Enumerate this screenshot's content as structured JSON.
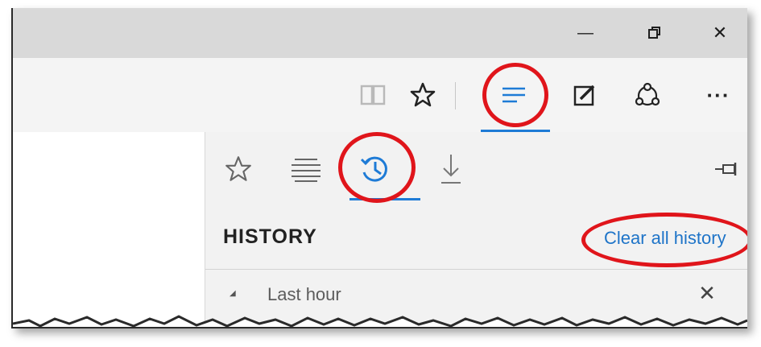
{
  "window_controls": {
    "minimize_icon": "minimize-icon",
    "restore_icon": "restore-icon",
    "close_icon": "close-icon",
    "minimize_glyph": "—",
    "close_glyph": "✕"
  },
  "toolbar": {
    "items": [
      {
        "name": "reading-view-icon",
        "state": "disabled"
      },
      {
        "name": "favorites-star-icon",
        "state": "normal"
      },
      {
        "name": "hub-icon",
        "state": "active"
      },
      {
        "name": "web-note-icon",
        "state": "normal"
      },
      {
        "name": "share-icon",
        "state": "normal"
      },
      {
        "name": "more-icon",
        "state": "normal"
      }
    ],
    "more_glyph": "···"
  },
  "hub_panel": {
    "tabs": [
      {
        "name": "favorites-tab-icon",
        "active": false
      },
      {
        "name": "reading-list-tab-icon",
        "active": false
      },
      {
        "name": "history-tab-icon",
        "active": true
      },
      {
        "name": "downloads-tab-icon",
        "active": false
      }
    ],
    "pin_icon": "pin-icon",
    "title": "HISTORY",
    "clear_all_label": "Clear all history",
    "groups": [
      {
        "caret": "◢",
        "label": "Last hour",
        "close_glyph": "✕"
      }
    ]
  },
  "colors": {
    "accent": "#1e7bd6",
    "link": "#1e74c8",
    "annotation_red": "#e0151b",
    "titlebar": "#d9d9d9",
    "toolbar": "#f4f4f4",
    "panel": "#f2f2f2"
  }
}
